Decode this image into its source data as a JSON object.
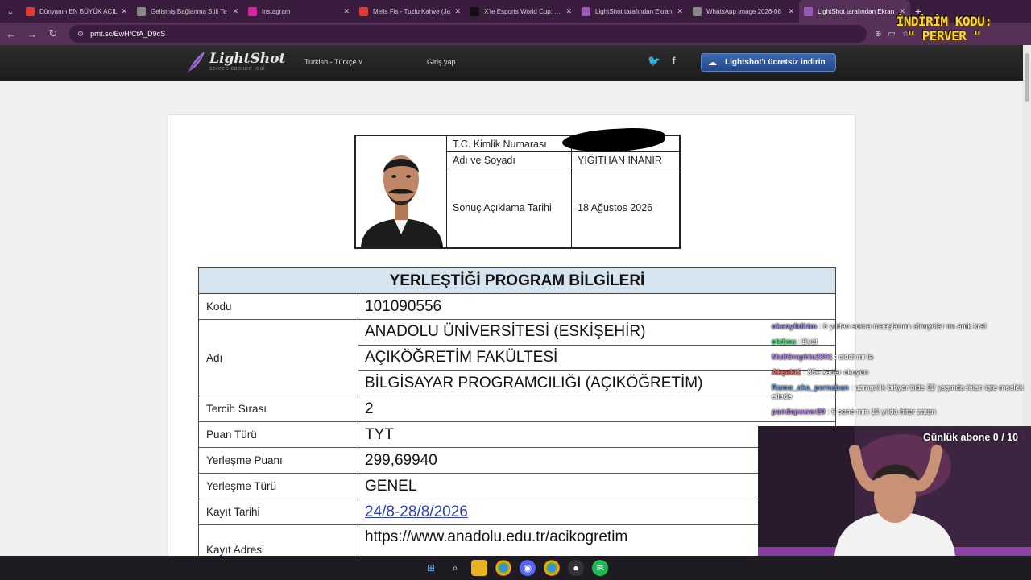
{
  "browser": {
    "tabs": [
      {
        "label": "Dünyanın EN BÜYÜK AÇIL",
        "icon": "youtube-icon",
        "color": "#e53935"
      },
      {
        "label": "Gelişmiş Bağlanma Stili Te",
        "icon": "globe-icon",
        "color": "#888888"
      },
      {
        "label": "Instagram",
        "icon": "instagram-icon",
        "color": "#d6249f"
      },
      {
        "label": "Melis Fis - Tuzlu Kahve (Ja",
        "icon": "youtube-icon",
        "color": "#e53935"
      },
      {
        "label": "X'te Esports World Cup: \"W",
        "icon": "x-icon",
        "color": "#111111"
      },
      {
        "label": "LightShot tarafından Ekran",
        "icon": "lightshot-icon",
        "color": "#9b59b6"
      },
      {
        "label": "WhatsApp Image 2026-08",
        "icon": "globe-icon",
        "color": "#888888"
      },
      {
        "label": "LightShot tarafından Ekran",
        "icon": "lightshot-icon",
        "color": "#9b59b6"
      }
    ],
    "url": "prnt.sc/EwHfCtA_D9cS"
  },
  "lightshot": {
    "logo_main": "LightShot",
    "logo_sub": "screen capture tool",
    "language": "Turkish - Türkçe",
    "login": "Giriş yap",
    "download": "Lightshot'ı ücretsiz indirin"
  },
  "document": {
    "id": {
      "tc_label": "T.C. Kimlik Numarası",
      "name_label": "Adı ve Soyadı",
      "name_value": "YİĞİTHAN İNANIR",
      "date_label": "Sonuç Açıklama Tarihi",
      "date_value": "18 Ağustos 2026"
    },
    "program": {
      "heading": "YERLEŞTİĞİ PROGRAM BİLGİLERİ",
      "kodu_label": "Kodu",
      "kodu": "101090556",
      "adi_label": "Adı",
      "adi_lines": [
        "ANADOLU ÜNİVERSİTESİ (ESKİŞEHİR)",
        "AÇIKÖĞRETİM FAKÜLTESİ",
        "BİLGİSAYAR PROGRAMCILIĞI (AÇIKÖĞRETİM)"
      ],
      "tercih_label": "Tercih Sırası",
      "tercih": "2",
      "puan_turu_label": "Puan Türü",
      "puan_turu": "TYT",
      "puan_label": "Yerleşme Puanı",
      "puan": "299,69940",
      "tur_label": "Yerleşme Türü",
      "tur": "GENEL",
      "kayit_tarihi_label": "Kayıt Tarihi",
      "kayit_tarihi": "24/8-28/8/2026",
      "kayit_adresi_label": "Kayıt Adresi",
      "kayit_adresi": "https://www.anadolu.edu.tr/acikogretim"
    }
  },
  "stream": {
    "promo_line1": "İNDİRİM KODU:",
    "promo_line2": "\" PERVER \"",
    "sub_goal": "Günlük abone 0 / 10",
    "chat": [
      {
        "user": "okanyildirim",
        "text": ": 6 yıldan sonra maaşlarımı almıyolar mı amk kral",
        "color": "#a78bfa"
      },
      {
        "user": "elebsu",
        "text": ": Evet",
        "color": "#4ade80"
      },
      {
        "user": "MaliGraphic2301",
        "text": ": ciddi mi la",
        "color": "#c084fc"
      },
      {
        "user": "Akşakt1",
        "text": ": 35e kadar okuyon",
        "color": "#f87171"
      },
      {
        "user": "Ramo_aka_pernaban",
        "text": ": uzmanlık bitiyor bide 32 yaşında falan işte meslek elinde",
        "color": "#60a5fa"
      },
      {
        "user": "pandapower20",
        "text": ": 6 sene min 10 yılda biter zaten",
        "color": "#c084fc"
      }
    ]
  }
}
